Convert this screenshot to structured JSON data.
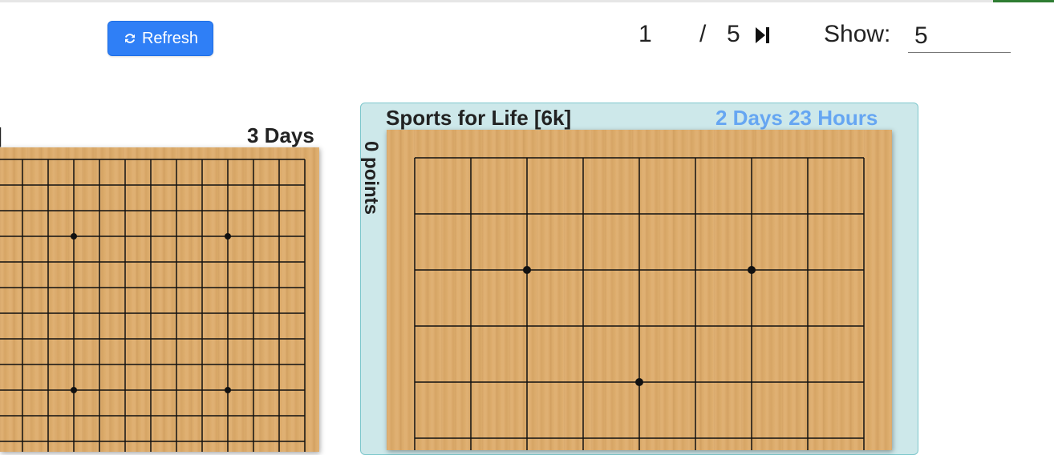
{
  "toolbar": {
    "refresh_label": "Refresh",
    "refresh_icon": "refresh-icon"
  },
  "pager": {
    "current_page": "1",
    "separator": "/",
    "total_pages": "5",
    "last_page_icon": "skip-to-end-icon",
    "show_label": "Show:",
    "show_value": "5"
  },
  "games": [
    {
      "player": "]",
      "time_left": "3 Days",
      "board_size": 19,
      "board_bg": "#ddaa68"
    },
    {
      "player": "Sports for Life  [6k]",
      "time_left": "2 Days 23 Hours",
      "points": "0 points",
      "board_size": 9,
      "highlight_color": "#cde8ea",
      "time_color": "#66a6f2"
    }
  ],
  "colors": {
    "primary_button": "#2f7ff6",
    "active_card_bg": "#cde8ea",
    "active_card_border": "#7dc7cc",
    "timer_accent": "#66a6f2"
  }
}
